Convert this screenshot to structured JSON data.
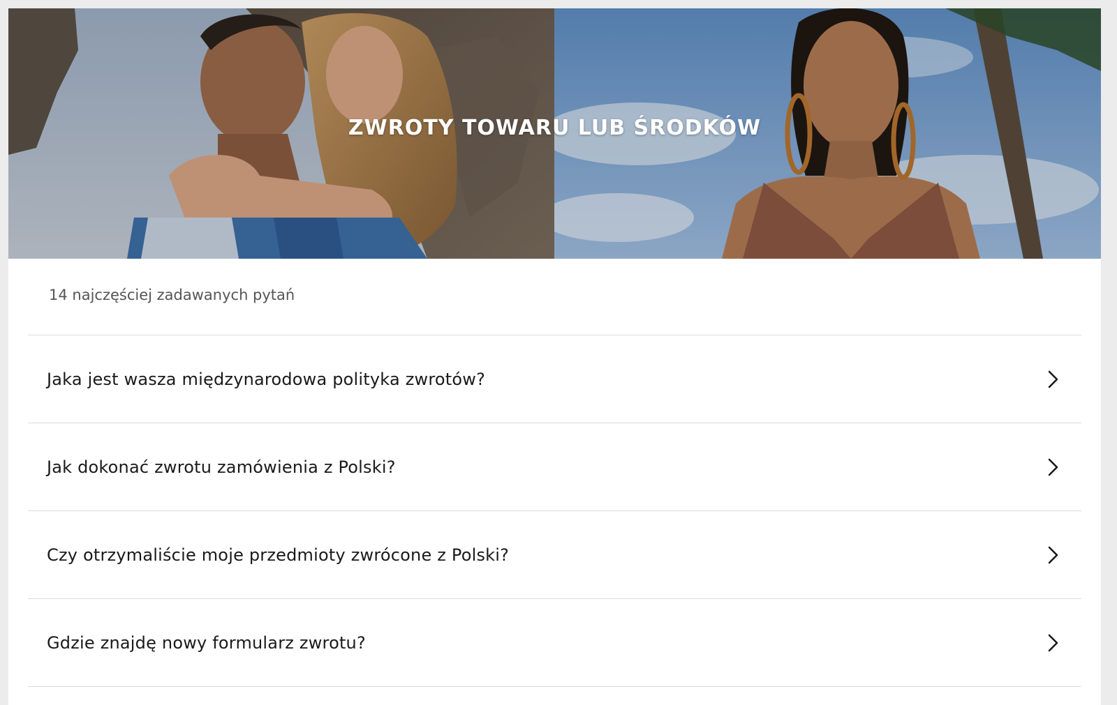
{
  "hero": {
    "title": "ZWROTY TOWARU LUB ŚRODKÓW"
  },
  "faq": {
    "count_label": "14 najczęściej zadawanych pytań",
    "items": [
      {
        "question": "Jaka jest wasza międzynarodowa polityka zwrotów?"
      },
      {
        "question": "Jak dokonać zwrotu zamówienia z Polski?"
      },
      {
        "question": "Czy otrzymaliście moje przedmioty zwrócone z Polski?"
      },
      {
        "question": "Gdzie znajdę nowy formularz zwrotu?"
      }
    ],
    "item_icon": "chevron-right-icon"
  },
  "colors": {
    "page_background": "#ececec",
    "card_background": "#ffffff",
    "divider": "#dcdcdc",
    "question_text": "#1a1a1a",
    "count_text": "#555555",
    "hero_title": "#ffffff"
  }
}
